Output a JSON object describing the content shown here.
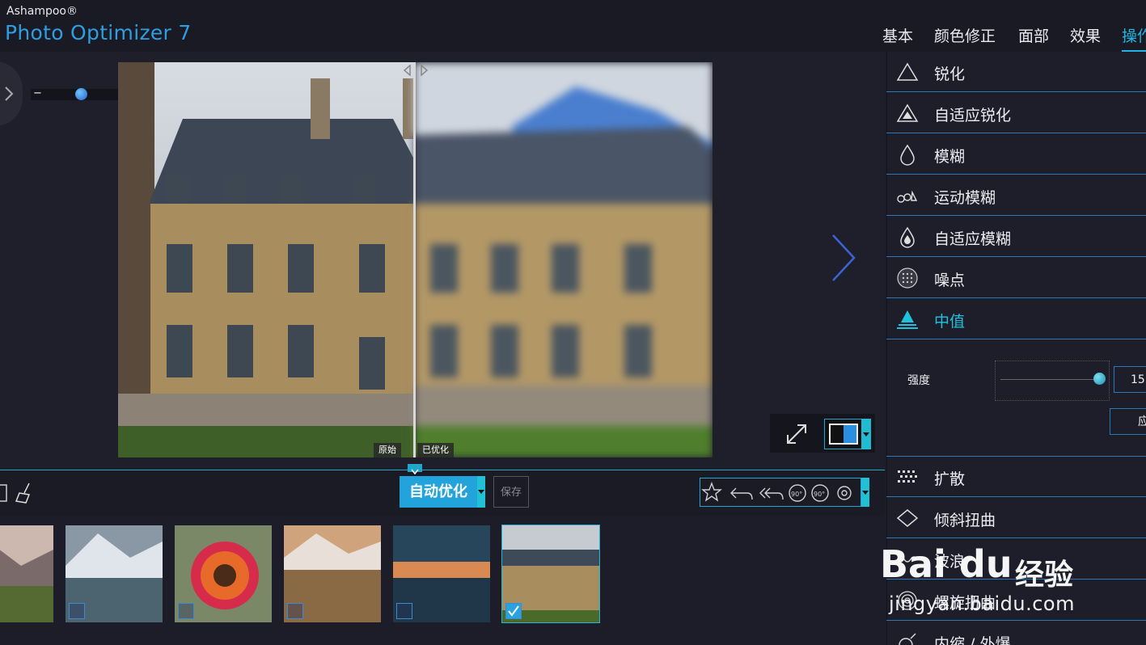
{
  "app": {
    "brand_small": "Ashampoo®",
    "brand_big": "Photo Optimizer 7"
  },
  "tabs": [
    {
      "label": "基本"
    },
    {
      "label": "颜色修正"
    },
    {
      "label": "面部"
    },
    {
      "label": "效果"
    },
    {
      "label": "操作"
    }
  ],
  "zoom": {
    "minus": "−",
    "plus": "+"
  },
  "compare": {
    "original": "原始",
    "optimized": "已优化"
  },
  "toolbar": {
    "auto_label": "自动优化",
    "save_label": "保存"
  },
  "operations": [
    {
      "label": "锐化",
      "icon": "triangle-outline-icon"
    },
    {
      "label": "自适应锐化",
      "icon": "triangle-filled-icon"
    },
    {
      "label": "模糊",
      "icon": "drop-outline-icon"
    },
    {
      "label": "运动模糊",
      "icon": "motion-blur-icon"
    },
    {
      "label": "自适应模糊",
      "icon": "drop-filled-icon"
    },
    {
      "label": "噪点",
      "icon": "noise-icon"
    },
    {
      "label": "中值",
      "icon": "median-icon"
    },
    {
      "label": "扩散",
      "icon": "diffuse-icon"
    },
    {
      "label": "倾斜扭曲",
      "icon": "diamond-icon"
    },
    {
      "label": "波浪",
      "icon": "wave-icon"
    },
    {
      "label": "螺旋扭曲",
      "icon": "swirl-icon"
    },
    {
      "label": "内缩 / 外爆",
      "icon": "implode-icon"
    }
  ],
  "median": {
    "strength_label": "强度",
    "value": "15",
    "apply_label": "应"
  },
  "thumbnails": [
    {
      "selected": false
    },
    {
      "selected": false
    },
    {
      "selected": false
    },
    {
      "selected": false
    },
    {
      "selected": false
    },
    {
      "selected": true
    }
  ],
  "watermark": {
    "logo": "Bai du",
    "cn": "经验",
    "url": "jingyan.baidu.com"
  },
  "colors": {
    "accent": "#1fb6e3",
    "brand": "#2f9ee0",
    "panel_bg": "#1e1e2a",
    "separator": "#2b78b8"
  }
}
